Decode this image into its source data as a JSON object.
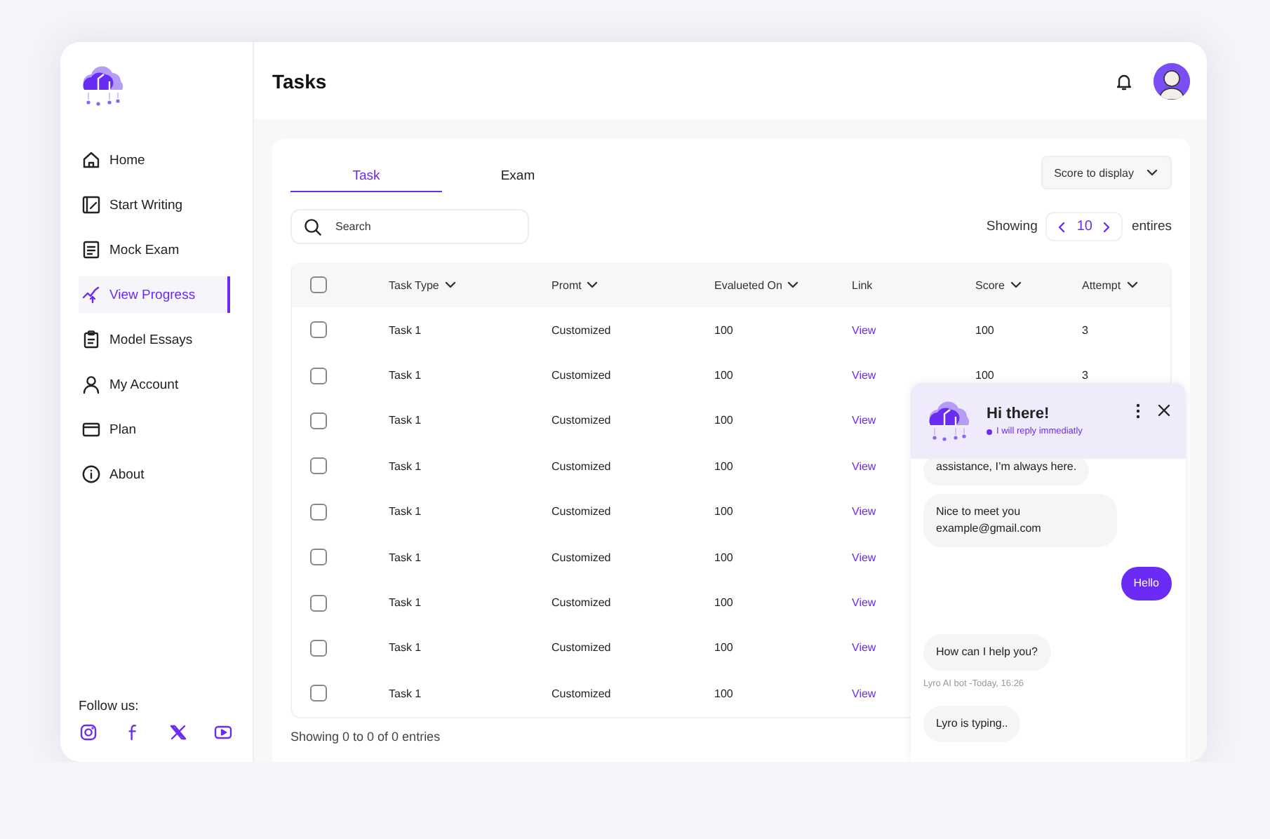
{
  "sidebar": {
    "items": [
      {
        "label": "Home",
        "selected": false
      },
      {
        "label": "Start Writing",
        "selected": false
      },
      {
        "label": "Mock Exam",
        "selected": false
      },
      {
        "label": "View Progress",
        "selected": true
      },
      {
        "label": "Model Essays",
        "selected": false
      },
      {
        "label": "My Account",
        "selected": false
      },
      {
        "label": "Plan",
        "selected": false
      },
      {
        "label": "About",
        "selected": false
      }
    ],
    "follow_label": "Follow us:"
  },
  "header": {
    "title": "Tasks"
  },
  "tabs": [
    {
      "label": "Task",
      "selected": true
    },
    {
      "label": "Exam",
      "selected": false
    }
  ],
  "score_dropdown": {
    "label": "Score to display"
  },
  "search": {
    "placeholder": "Search"
  },
  "page_size": {
    "prefix": "Showing",
    "value": "10",
    "suffix": "entires"
  },
  "table": {
    "header_checked": false,
    "columns": [
      "Task Type",
      "Promt",
      "Evalueted On",
      "Link",
      "Score",
      "Attempt"
    ],
    "rows": [
      {
        "checked": false,
        "task_type": "Task 1",
        "prompt": "Customized",
        "evaluated_on": "100",
        "link": "View",
        "score": "100",
        "attempt": "3"
      },
      {
        "checked": false,
        "task_type": "Task 1",
        "prompt": "Customized",
        "evaluated_on": "100",
        "link": "View",
        "score": "100",
        "attempt": "3"
      },
      {
        "checked": false,
        "task_type": "Task 1",
        "prompt": "Customized",
        "evaluated_on": "100",
        "link": "View"
      },
      {
        "checked": false,
        "task_type": "Task 1",
        "prompt": "Customized",
        "evaluated_on": "100",
        "link": "View"
      },
      {
        "checked": false,
        "task_type": "Task 1",
        "prompt": "Customized",
        "evaluated_on": "100",
        "link": "View"
      },
      {
        "checked": false,
        "task_type": "Task 1",
        "prompt": "Customized",
        "evaluated_on": "100",
        "link": "View"
      },
      {
        "checked": false,
        "task_type": "Task 1",
        "prompt": "Customized",
        "evaluated_on": "100",
        "link": "View"
      },
      {
        "checked": false,
        "task_type": "Task 1",
        "prompt": "Customized",
        "evaluated_on": "100",
        "link": "View"
      },
      {
        "checked": false,
        "task_type": "Task 1",
        "prompt": "Customized",
        "evaluated_on": "100",
        "link": "View"
      }
    ]
  },
  "footer": "Showing 0 to 0 of 0 entries",
  "chat": {
    "title": "Hi there!",
    "status": "I will reply immediatly",
    "messages": [
      {
        "kind": "bot",
        "text": "assistance, I’m always here."
      },
      {
        "kind": "bot",
        "text": "Nice to meet you example@gmail.com"
      },
      {
        "kind": "user",
        "text": "Hello"
      },
      {
        "kind": "bot",
        "text": "How can I help you?",
        "meta": "Lyro AI bot -Today, 16:26"
      },
      {
        "kind": "bot",
        "text": "Lyro is typing.."
      }
    ]
  }
}
